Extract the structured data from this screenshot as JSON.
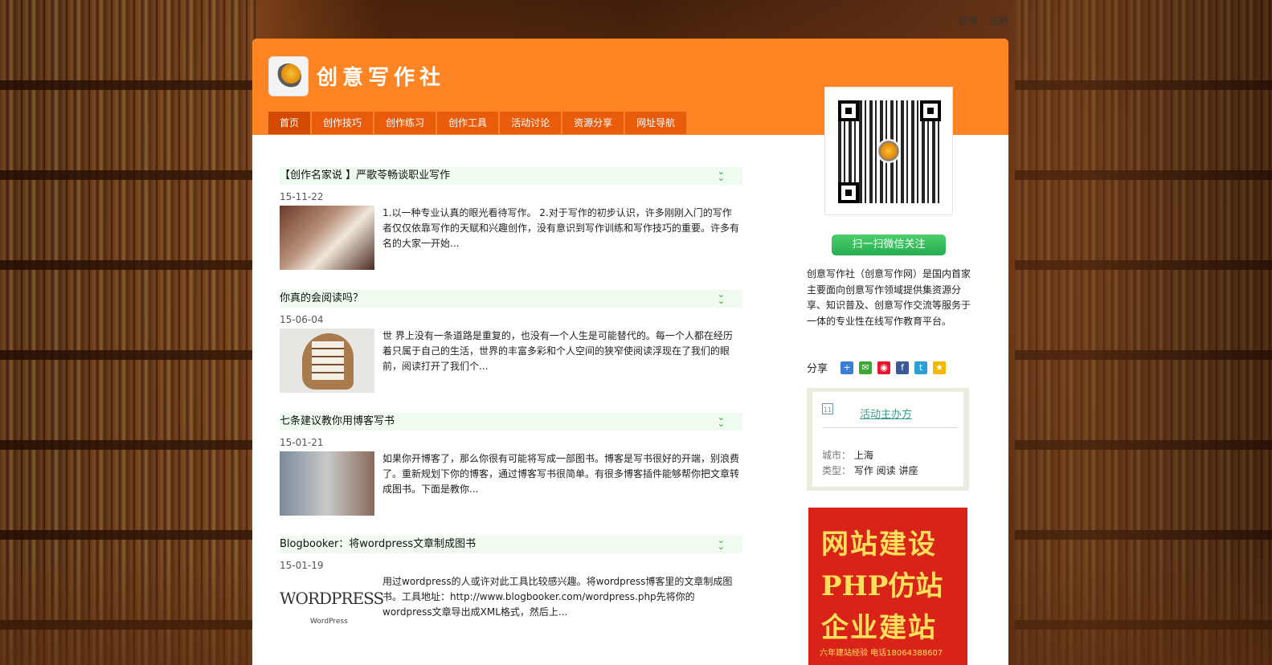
{
  "top_links": {
    "login": "登录",
    "register": "注册"
  },
  "header": {
    "site_name": "创意写作社",
    "brand_color": "#ff8424"
  },
  "nav": [
    {
      "label": "首页",
      "active": true
    },
    {
      "label": "创作技巧",
      "active": false
    },
    {
      "label": "创作练习",
      "active": false
    },
    {
      "label": "创作工具",
      "active": false
    },
    {
      "label": "活动讨论",
      "active": false
    },
    {
      "label": "资源分享",
      "active": false
    },
    {
      "label": "网址导航",
      "active": false
    }
  ],
  "posts": [
    {
      "title": "【创作名家说 】严歌苓畅谈职业写作",
      "date": "15-11-22",
      "excerpt": "1.以一种专业认真的眼光看待写作。 2.对于写作的初步认识，许多刚刚入门的写作者仅仅依靠写作的天赋和兴趣创作，没有意识到写作训练和写作技巧的重要。许多有名的大家一开始..."
    },
    {
      "title": "你真的会阅读吗？",
      "date": "15-06-04",
      "excerpt": "世 界上没有一条道路是重复的，也没有一个人生是可能替代的。每一个人都在经历着只属于自己的生活，世界的丰富多彩和个人空间的狭窄使阅读浮现在了我们的眼 前，阅读打开了我们个..."
    },
    {
      "title": "七条建议教你用博客写书",
      "date": "15-01-21",
      "excerpt": "如果你开博客了，那么你很有可能将写成一部图书。博客是写书很好的开端，别浪费了。重新规划下你的博客，通过博客写书很简单。有很多博客插件能够帮你把文章转成图书。下面是教你..."
    },
    {
      "title": "Blogbooker：将wordpress文章制成图书",
      "date": "15-01-19",
      "excerpt": "用过wordpress的人或许对此工具比较感兴趣。将wordpress博客里的文章制成图书。工具地址：http://www.blogbooker.com/wordpress.php先将你的wordpress文章导出成XML格式，然后上...",
      "thumb_text": "WORDPRESS",
      "thumb_sub": "WordPress"
    }
  ],
  "sidebar": {
    "wechat_button": "扫一扫微信关注",
    "about": "创意写作社（创意写作网）是国内首家主要面向创意写作领域提供集资源分享、知识普及、创意写作交流等服务于一体的专业性在线写作教育平台。",
    "share_label": "分享",
    "share_icons": [
      {
        "name": "more-share-icon",
        "color": "#3b7fd4",
        "glyph": "+"
      },
      {
        "name": "wechat-icon",
        "color": "#3aaa35",
        "glyph": "✉"
      },
      {
        "name": "weibo-icon",
        "color": "#e6162d",
        "glyph": "◉"
      },
      {
        "name": "facebook-icon",
        "color": "#3b5998",
        "glyph": "f"
      },
      {
        "name": "twitter-icon",
        "color": "#2a9fd8",
        "glyph": "t"
      },
      {
        "name": "qzone-icon",
        "color": "#f5b800",
        "glyph": "★"
      }
    ],
    "event": {
      "cal_day": "11",
      "link": "活动主办方",
      "city_key": "城市：",
      "city_val": "上海",
      "type_key": "类型：",
      "type_val": "写作 阅读 讲座"
    },
    "ad": {
      "line1": "网站建设",
      "line2": "PHP仿站",
      "line3": "企业建站",
      "line4": "六年建站经验  电话18064388607"
    }
  }
}
